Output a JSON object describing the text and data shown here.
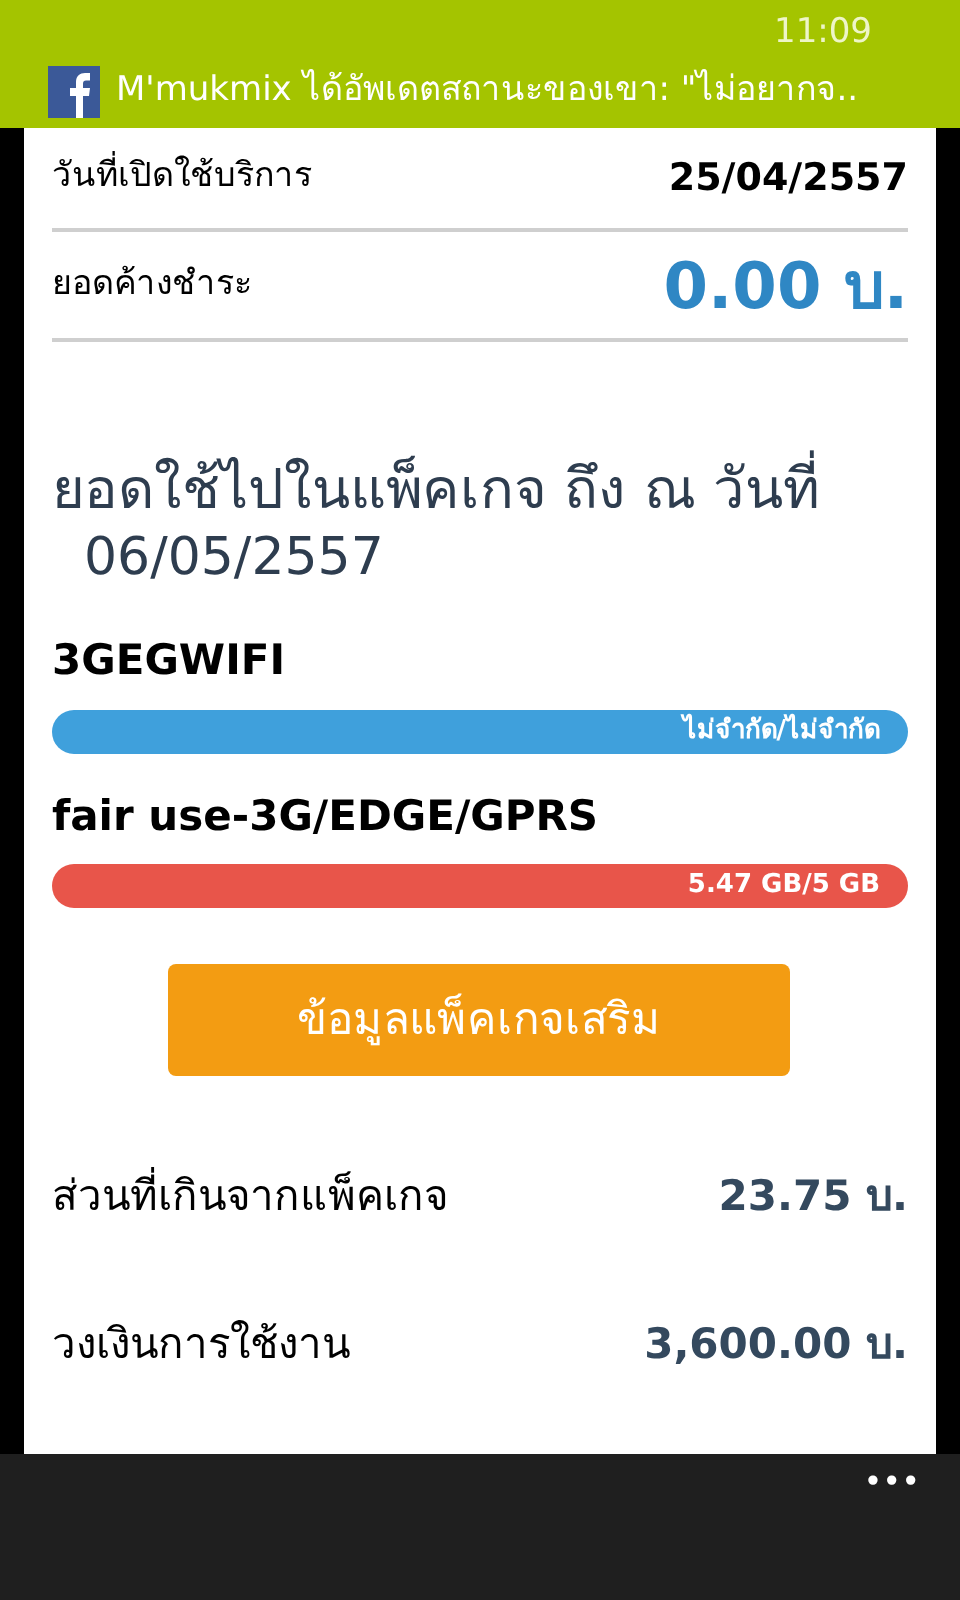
{
  "status_bar": {
    "time": "11:09"
  },
  "notification": {
    "text": "M'mukmix ได้อัพเดตสถานะของเขา: \"ไม่อยากจ.."
  },
  "summary": [
    {
      "label": "วันที่เปิดใช้บริการ",
      "value": "25/04/2557",
      "kind": "plain"
    },
    {
      "label": "ยอดค้างชำระ",
      "value": "0.00 บ.",
      "kind": "highlight"
    }
  ],
  "usage": {
    "title": "ยอดใช้ไปในแพ็คเกจ ถึง ณ วันที่",
    "date": "06/05/2557"
  },
  "packages": [
    {
      "name": "3GEGWIFI",
      "reading": "ไม่จำกัด/ไม่จำกัด",
      "color": "#3fa0dc"
    },
    {
      "name": "fair use-3G/EDGE/GPRS",
      "reading": "5.47 GB/5 GB",
      "color": "#e8554a"
    }
  ],
  "more_button": "ข้อมูลแพ็คเกจเสริม",
  "totals": [
    {
      "label": "ส่วนที่เกินจากแพ็คเกจ",
      "value": "23.75 บ."
    },
    {
      "label": "วงเงินการใช้งาน",
      "value": "3,600.00 บ."
    }
  ],
  "app_bar": {
    "more": "•••"
  }
}
